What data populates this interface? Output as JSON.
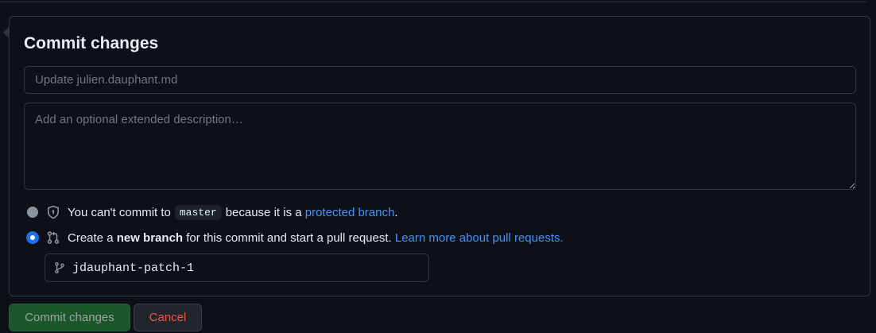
{
  "form": {
    "title": "Commit changes",
    "summary_placeholder": "Update julien.dauphant.md",
    "description_placeholder": "Add an optional extended description…"
  },
  "options": {
    "direct": {
      "text_before": "You can't commit to",
      "branch": "master",
      "text_after": "because it is a",
      "link": "protected branch",
      "period": ".",
      "icon": "shield-lock-icon",
      "selected": false,
      "disabled": true
    },
    "new_branch": {
      "text_before": "Create a",
      "bold": "new branch",
      "text_after": "for this commit and start a pull request.",
      "link": "Learn more about pull requests.",
      "icon": "git-pull-request-icon",
      "selected": true
    }
  },
  "branch_name": {
    "value": "jdauphant-patch-1",
    "icon": "git-branch-icon"
  },
  "buttons": {
    "commit": "Commit changes",
    "cancel": "Cancel"
  },
  "colors": {
    "background": "#0d1117",
    "border": "#30363d",
    "link": "#4493f8",
    "primary": "#238636",
    "danger": "#f85149"
  }
}
